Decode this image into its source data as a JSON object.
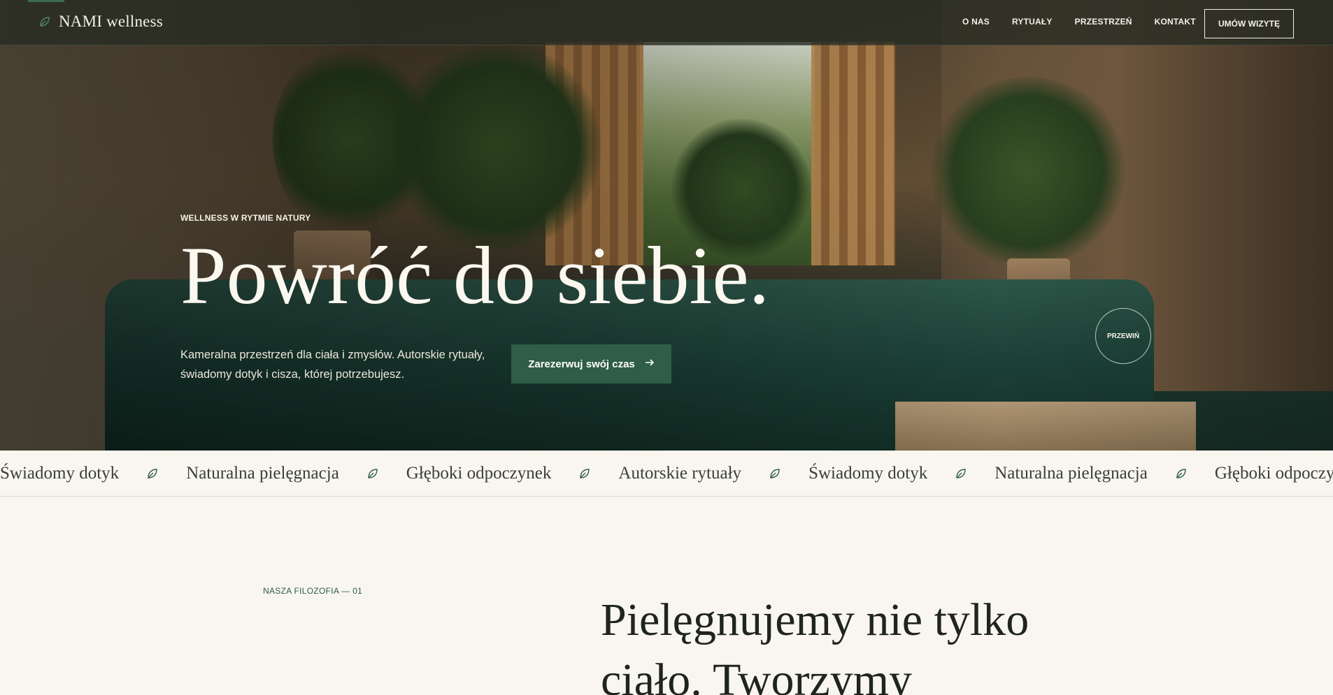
{
  "brand": {
    "name": "NAMI wellness",
    "icon": "leaf-icon"
  },
  "nav": {
    "links": [
      "O NAS",
      "RYTUAŁY",
      "PRZESTRZEŃ",
      "KONTAKT"
    ],
    "cta": "UMÓW WIZYTĘ"
  },
  "hero": {
    "eyebrow": "WELLNESS W RYTMIE NATURY",
    "title": "Powróć do siebie.",
    "subtitle_line1": "Kameralna przestrzeń dla ciała i zmysłów. Autorskie rytuały,",
    "subtitle_line2": "świadomy dotyk i cisza, której potrzebujesz.",
    "cta": "Zarezerwuj swój czas",
    "cta_icon": "arrow-right-icon",
    "scroll_label": "PRZEWIŃ"
  },
  "marquee": {
    "items": [
      "Świadomy dotyk",
      "Naturalna pielęgnacja",
      "Głęboki odpoczynek",
      "Autorskie rytuały",
      "Świadomy dotyk",
      "Naturalna pielęgnacja",
      "Głęboki odpoczynek"
    ],
    "separator_icon": "leaf-icon"
  },
  "philosophy": {
    "label": "NASZA FILOZOFIA — 01",
    "title_line1": "Pielęgnujemy nie tylko",
    "title_line2": "ciało. Tworzymy"
  },
  "colors": {
    "accent": "#2f5d45",
    "background": "#f8f6ef",
    "nav_bg": "#282c22"
  }
}
